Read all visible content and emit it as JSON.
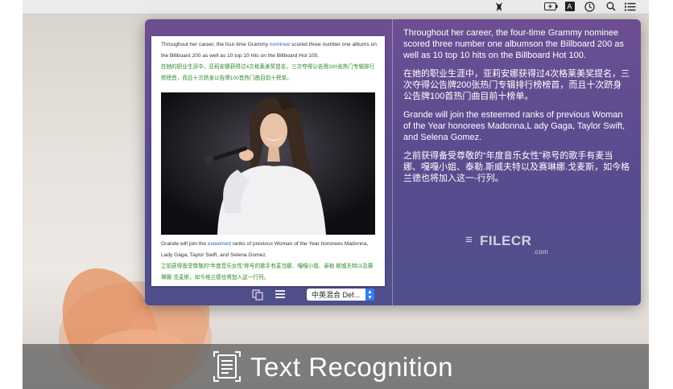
{
  "menubar": {
    "icons": [
      "recognition-app-icon",
      "battery-icon",
      "text-input-icon",
      "clock-icon",
      "search-icon",
      "menu-list-icon"
    ],
    "text_icon_label": "A"
  },
  "document": {
    "en_para1_before": "Throughout her career, the four-time Grammy ",
    "en_para1_highlight": "nominee",
    "en_para1_after": " scored three number one albums on the Billboard 200 as well as 10 top 10 hits on the Billboard Hot 100.",
    "zh_para1": "在她的职业生涯中，亚莉安娜获得过4次格莱美奖提名，三次夺得公告牌200张热门专辑排行榜榜首，而且十次跻身公告牌100首热门曲目前十榜单。",
    "en_para2_before": "Grande will join the ",
    "en_para2_highlight": "esteemed",
    "en_para2_after": " ranks of previous Woman of the Year honorees Madonna, Lady Gaga, Taylor Swift, and Selena Gomez.",
    "zh_para2": "之前获得备受尊敬的“年度音乐女性”称号的歌手有麦当娜、嘎嘎小姐、泰勒.斯威夫特以及赛琳娜·戈麦斯，如今格兰德也将加入这一行列。"
  },
  "toolbar": {
    "language_select_value": "中英混合  Def..."
  },
  "result": {
    "paragraphs": [
      "Throughout her career, the four-time Grammy nominee scored three number one albumson the Billboard 200 as well as 10 top 10 hits on the Billboard Hot 100.",
      "在她的职业生涯中，亚莉安娜获得过4次格莱美奖提名，三次夺得公告牌200张热门专辑排行榜榜首，而且十次跻身公告牌100首热门曲目前十榜单。",
      "Grande will join the esteemed ranks of previous Woman of the Year honorees Madonna,L ady Gaga, Taylor Swift, and Selena Gomez.",
      "之前获得备受尊敬的“年度音乐女性”称号的歌手有麦当娜、嘎嘎小姐、泰勒.斯威夫特以及赛琳娜.戈麦斯，如今格兰德也将加入这一-行列。"
    ]
  },
  "watermark": {
    "text": "FILECR",
    "suffix": ".com"
  },
  "banner": {
    "title": "Text Recognition"
  },
  "colors": {
    "popup_top": "#6d4f93",
    "popup_bottom": "#4e4f8b",
    "chinese_text": "#2f8a2a",
    "highlight_word": "#2a64c8",
    "select_accent": "#2f7df6"
  }
}
